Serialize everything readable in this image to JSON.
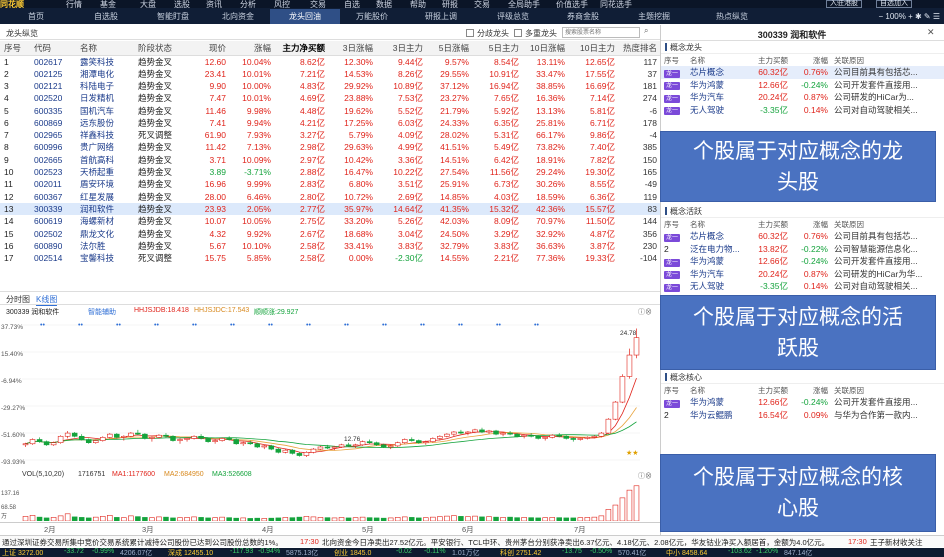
{
  "app": {
    "name": "同花顺"
  },
  "menubar": {
    "items": [
      "行情",
      "基金",
      "大盘",
      "选股",
      "资讯",
      "分析",
      "风控",
      "交易",
      "自选",
      "数据",
      "帮助",
      "研报",
      "交易",
      "全局助手",
      "价值选手",
      "同花选手"
    ],
    "right_buttons": [
      "入驻港股",
      "自选加入"
    ]
  },
  "navbar": {
    "items": [
      "首页",
      "自选股",
      "智能盯盘",
      "北向资金",
      "龙头回油",
      "万能股价",
      "研报上调",
      "评级总览",
      "券商金股",
      "主题挖掘",
      "热点纵览"
    ],
    "active_index": 4,
    "zoom": "100%"
  },
  "grid": {
    "title": "龙头纵览",
    "checkbox1": "分歧龙头",
    "checkbox2": "多重龙头",
    "search_placeholder": "搜索股票名称",
    "columns": [
      "序号",
      "代码",
      "名称",
      "阶段状态",
      "现价",
      "涨幅",
      "主力净买额",
      "3日涨幅",
      "3日主力",
      "5日涨幅",
      "5日主力",
      "10日涨幅",
      "10日主力",
      "热度排名"
    ],
    "rows": [
      [
        "1",
        "002617",
        "露笑科技",
        "趋势金叉",
        "12.60",
        "10.04%",
        "8.62亿",
        "12.30%",
        "9.44亿",
        "9.57%",
        "8.54亿",
        "13.11%",
        "12.65亿",
        "117"
      ],
      [
        "2",
        "002125",
        "湘潭电化",
        "趋势金叉",
        "23.41",
        "10.01%",
        "7.21亿",
        "14.53%",
        "8.26亿",
        "29.55%",
        "10.91亿",
        "33.47%",
        "17.55亿",
        "37"
      ],
      [
        "3",
        "002121",
        "科陆电子",
        "趋势金叉",
        "9.90",
        "10.00%",
        "4.83亿",
        "29.92%",
        "10.89亿",
        "37.12%",
        "16.94亿",
        "38.85%",
        "16.69亿",
        "181"
      ],
      [
        "4",
        "002520",
        "日发精机",
        "趋势金叉",
        "7.47",
        "10.01%",
        "4.69亿",
        "23.88%",
        "7.53亿",
        "23.27%",
        "7.65亿",
        "16.36%",
        "7.14亿",
        "274"
      ],
      [
        "5",
        "600335",
        "国机汽车",
        "趋势金叉",
        "11.46",
        "9.98%",
        "4.48亿",
        "19.62%",
        "5.52亿",
        "21.79%",
        "5.92亿",
        "13.13%",
        "5.81亿",
        "-6"
      ],
      [
        "6",
        "600869",
        "远东股份",
        "趋势金叉",
        "7.41",
        "9.94%",
        "4.21亿",
        "17.25%",
        "6.03亿",
        "24.33%",
        "6.35亿",
        "25.81%",
        "6.71亿",
        "178"
      ],
      [
        "7",
        "002965",
        "祥鑫科技",
        "死叉调整",
        "61.90",
        "7.93%",
        "3.27亿",
        "5.79%",
        "4.09亿",
        "28.02%",
        "5.31亿",
        "66.17%",
        "9.86亿",
        "-4"
      ],
      [
        "8",
        "600996",
        "贵广网络",
        "趋势金叉",
        "11.42",
        "7.13%",
        "2.98亿",
        "29.63%",
        "4.99亿",
        "41.51%",
        "5.49亿",
        "73.82%",
        "7.40亿",
        "385"
      ],
      [
        "9",
        "002665",
        "首航高科",
        "趋势金叉",
        "3.71",
        "10.09%",
        "2.97亿",
        "10.42%",
        "3.36亿",
        "14.51%",
        "6.42亿",
        "18.91%",
        "7.82亿",
        "150"
      ],
      [
        "10",
        "002523",
        "天桥起重",
        "趋势金叉",
        "3.89",
        "-3.71%",
        "2.88亿",
        "16.47%",
        "10.22亿",
        "27.54%",
        "11.56亿",
        "29.24%",
        "19.30亿",
        "165"
      ],
      [
        "11",
        "002011",
        "盾安环境",
        "趋势金叉",
        "16.96",
        "9.99%",
        "2.83亿",
        "6.80%",
        "3.51亿",
        "25.91%",
        "6.73亿",
        "30.26%",
        "8.55亿",
        "-49"
      ],
      [
        "12",
        "600367",
        "红星发展",
        "趋势金叉",
        "28.00",
        "6.46%",
        "2.80亿",
        "10.72%",
        "2.69亿",
        "14.85%",
        "4.03亿",
        "18.59%",
        "6.36亿",
        "119"
      ],
      [
        "13",
        "300339",
        "润和软件",
        "趋势金叉",
        "23.93",
        "2.05%",
        "2.77亿",
        "35.97%",
        "14.64亿",
        "41.35%",
        "15.32亿",
        "42.36%",
        "15.57亿",
        "83"
      ],
      [
        "14",
        "600619",
        "海螺新材",
        "趋势金叉",
        "10.07",
        "10.05%",
        "2.75亿",
        "33.20%",
        "5.26亿",
        "42.03%",
        "8.09亿",
        "70.97%",
        "11.50亿",
        "144"
      ],
      [
        "15",
        "002502",
        "鼎龙文化",
        "趋势金叉",
        "4.32",
        "9.92%",
        "2.67亿",
        "18.68%",
        "3.04亿",
        "24.50%",
        "3.29亿",
        "32.92%",
        "4.87亿",
        "356"
      ],
      [
        "16",
        "600890",
        "法尔胜",
        "趋势金叉",
        "5.67",
        "10.10%",
        "2.58亿",
        "33.41%",
        "3.83亿",
        "32.79%",
        "3.83亿",
        "36.63%",
        "3.87亿",
        "230"
      ],
      [
        "17",
        "002514",
        "宝馨科技",
        "死叉调整",
        "15.75",
        "5.85%",
        "2.58亿",
        "0.00%",
        "-2.30亿",
        "14.55%",
        "2.21亿",
        "77.36%",
        "19.33亿",
        "-104"
      ]
    ],
    "selected_index": 12
  },
  "chart_tabs": [
    "分时图",
    "K线图"
  ],
  "chart_tab_active": 1,
  "kline": {
    "stock": "300339 润和软件",
    "ind": "智能辅助",
    "ma1": "HHJSJDB:18.418",
    "ma2": "HHJSJDC:17.543",
    "ma3": "顺顺涨:29.927",
    "yticks": [
      "37.73%",
      "15.40%",
      "-6.94%",
      "-29.27%",
      "-51.60%",
      "-93.93%"
    ],
    "high_label": "24.78",
    "low_label": "12.76",
    "chart_data": {
      "type": "candlestick",
      "points": [
        [
          13.9,
          14.1,
          13.7,
          14.0
        ],
        [
          14.0,
          14.5,
          13.9,
          14.4
        ],
        [
          14.4,
          14.6,
          14.1,
          14.2
        ],
        [
          14.2,
          14.3,
          13.8,
          13.9
        ],
        [
          13.9,
          14.2,
          13.8,
          14.1
        ],
        [
          14.1,
          14.8,
          14.0,
          14.7
        ],
        [
          14.7,
          15.2,
          14.5,
          15.0
        ],
        [
          15.0,
          15.1,
          14.6,
          14.7
        ],
        [
          14.7,
          14.9,
          14.3,
          14.4
        ],
        [
          14.4,
          14.5,
          14.0,
          14.1
        ],
        [
          14.1,
          14.4,
          14.0,
          14.3
        ],
        [
          14.3,
          14.7,
          14.2,
          14.6
        ],
        [
          14.6,
          15.0,
          14.5,
          14.9
        ],
        [
          14.9,
          15.0,
          14.5,
          14.6
        ],
        [
          14.6,
          14.8,
          14.3,
          14.7
        ],
        [
          14.7,
          15.1,
          14.6,
          15.0
        ],
        [
          15.0,
          15.3,
          14.8,
          14.9
        ],
        [
          14.9,
          15.0,
          14.4,
          14.5
        ],
        [
          14.5,
          14.7,
          14.2,
          14.6
        ],
        [
          14.6,
          14.9,
          14.5,
          14.8
        ],
        [
          14.8,
          15.0,
          14.6,
          14.7
        ],
        [
          14.7,
          14.8,
          14.2,
          14.3
        ],
        [
          14.3,
          14.5,
          14.0,
          14.4
        ],
        [
          14.4,
          14.6,
          14.2,
          14.5
        ],
        [
          14.5,
          14.8,
          14.4,
          14.7
        ],
        [
          14.7,
          14.9,
          14.4,
          14.5
        ],
        [
          14.5,
          14.6,
          14.1,
          14.2
        ],
        [
          14.2,
          14.4,
          14.0,
          14.3
        ],
        [
          14.3,
          14.6,
          14.2,
          14.5
        ],
        [
          14.5,
          14.7,
          14.3,
          14.4
        ],
        [
          14.4,
          14.5,
          13.9,
          14.0
        ],
        [
          14.0,
          14.2,
          13.8,
          14.1
        ],
        [
          14.1,
          14.3,
          13.9,
          14.0
        ],
        [
          14.0,
          14.1,
          13.6,
          13.7
        ],
        [
          13.7,
          13.9,
          13.5,
          13.8
        ],
        [
          13.8,
          13.9,
          13.4,
          13.5
        ],
        [
          13.5,
          13.6,
          13.1,
          13.2
        ],
        [
          13.2,
          13.5,
          13.1,
          13.4
        ],
        [
          13.4,
          13.5,
          13.0,
          13.1
        ],
        [
          13.1,
          13.2,
          12.8,
          12.9
        ],
        [
          12.9,
          13.3,
          12.76,
          13.2
        ],
        [
          13.2,
          13.6,
          13.1,
          13.5
        ],
        [
          13.5,
          13.8,
          13.4,
          13.7
        ],
        [
          13.7,
          13.9,
          13.5,
          13.6
        ],
        [
          13.6,
          13.8,
          13.4,
          13.7
        ],
        [
          13.7,
          14.0,
          13.6,
          13.9
        ],
        [
          13.9,
          14.1,
          13.7,
          13.8
        ],
        [
          13.8,
          14.0,
          13.6,
          13.9
        ],
        [
          13.9,
          14.3,
          13.8,
          14.2
        ],
        [
          14.2,
          14.4,
          14.0,
          14.1
        ],
        [
          14.1,
          14.2,
          13.8,
          13.9
        ],
        [
          13.9,
          14.0,
          13.6,
          13.7
        ],
        [
          13.7,
          13.9,
          13.5,
          13.8
        ],
        [
          13.8,
          14.2,
          13.7,
          14.1
        ],
        [
          14.1,
          14.5,
          14.0,
          14.4
        ],
        [
          14.4,
          14.6,
          14.2,
          14.3
        ],
        [
          14.3,
          14.4,
          14.0,
          14.1
        ],
        [
          14.1,
          14.3,
          13.9,
          14.2
        ],
        [
          14.2,
          14.6,
          14.1,
          14.5
        ],
        [
          14.5,
          14.8,
          14.3,
          14.7
        ],
        [
          14.7,
          15.0,
          14.6,
          14.9
        ],
        [
          14.9,
          15.2,
          14.7,
          15.1
        ],
        [
          15.1,
          15.3,
          14.9,
          15.0
        ],
        [
          15.0,
          15.2,
          14.8,
          15.1
        ],
        [
          15.1,
          15.4,
          15.0,
          15.3
        ],
        [
          15.3,
          15.5,
          15.0,
          15.1
        ],
        [
          15.1,
          15.3,
          14.9,
          15.2
        ],
        [
          15.2,
          15.3,
          14.8,
          14.9
        ],
        [
          14.9,
          15.1,
          14.7,
          15.0
        ],
        [
          15.0,
          15.2,
          14.8,
          14.9
        ],
        [
          14.9,
          15.0,
          14.6,
          14.7
        ],
        [
          14.7,
          14.9,
          14.5,
          14.8
        ],
        [
          14.8,
          15.0,
          14.6,
          14.7
        ],
        [
          14.7,
          14.8,
          14.4,
          14.5
        ],
        [
          14.5,
          14.7,
          14.3,
          14.6
        ],
        [
          14.6,
          14.9,
          14.5,
          14.8
        ],
        [
          14.8,
          15.0,
          14.6,
          14.7
        ],
        [
          14.7,
          14.8,
          14.4,
          14.5
        ],
        [
          14.5,
          14.6,
          14.2,
          14.4
        ],
        [
          14.4,
          14.6,
          14.3,
          14.5
        ],
        [
          14.5,
          14.7,
          14.4,
          14.6
        ],
        [
          14.6,
          14.8,
          14.5,
          14.7
        ],
        [
          14.7,
          15.1,
          14.6,
          15.0
        ],
        [
          15.0,
          16.4,
          14.9,
          16.3
        ],
        [
          16.3,
          18.0,
          16.2,
          17.9
        ],
        [
          17.9,
          20.5,
          17.8,
          20.3
        ],
        [
          20.3,
          22.9,
          20.1,
          22.3
        ],
        [
          22.3,
          24.78,
          22.0,
          23.93
        ]
      ]
    }
  },
  "volume": {
    "label": "VOL(5,10,20)",
    "value": "1716751",
    "ma1": "MA1:1177600",
    "ma2": "MA2:684950",
    "ma3": "MA3:526608",
    "yticks": [
      "137.16",
      "68.58",
      "万"
    ],
    "chart_data": {
      "type": "bar",
      "values": [
        18,
        22,
        15,
        12,
        14,
        20,
        28,
        16,
        14,
        12,
        15,
        18,
        22,
        14,
        13,
        20,
        17,
        14,
        13,
        16,
        15,
        12,
        13,
        14,
        16,
        14,
        12,
        13,
        15,
        13,
        11,
        12,
        10,
        11,
        10,
        11,
        12,
        14,
        13,
        15,
        18,
        16,
        14,
        13,
        12,
        14,
        12,
        13,
        15,
        13,
        12,
        11,
        12,
        14,
        16,
        14,
        12,
        13,
        15,
        17,
        19,
        21,
        18,
        17,
        19,
        16,
        17,
        15,
        14,
        15,
        13,
        14,
        13,
        12,
        13,
        14,
        13,
        12,
        12,
        13,
        14,
        15,
        20,
        45,
        62,
        90,
        120,
        137
      ]
    }
  },
  "xaxis": {
    "labels": [
      "2月",
      "3月",
      "4月",
      "5月",
      "6月",
      "7月"
    ]
  },
  "news": {
    "time1": "17:30",
    "text1": "通过深圳证券交易所集中竞价交易系统累计减持公司股份已达到公司股份总数的1%。",
    "time2": "17:30",
    "text2": "北向资金今日净卖出27.52亿元。平安银行、TCL中环、贵州茅台分别获净卖出6.37亿元、4.18亿元、2.08亿元，华友钴业净买入额居首，金额为4.0亿元。",
    "time3": "17:30",
    "text3": "王子新材收关注"
  },
  "status": {
    "items": [
      "上证 3272.00",
      "-33.72",
      "-0.99%",
      "4206.07亿",
      "深成 12455.10",
      "-117.93",
      "-0.94%",
      "5875.13亿",
      "创业 1845.0",
      "-0.02",
      "-0.11%",
      "1.01万亿",
      "科创 2751.42",
      "-13.75",
      "-0.50%",
      "570.41亿",
      "中小 8458.64",
      "-103.62",
      "-1.20%",
      "847.14亿"
    ]
  },
  "right": {
    "title": "300339 润和软件",
    "sections": [
      {
        "name": "概念龙头",
        "cols": [
          "序号",
          "名称",
          "主力买额",
          "涨幅",
          "关联原因"
        ],
        "rows": [
          [
            "龙一",
            "芯片概念",
            "60.32亿",
            "0.76%",
            "公司目前具有包括芯..."
          ],
          [
            "龙一",
            "华为鸿蒙",
            "12.66亿",
            "-0.24%",
            "公司开发套件直接用..."
          ],
          [
            "龙一",
            "华为汽车",
            "20.24亿",
            "0.87%",
            "公司研发的HiCar为..."
          ],
          [
            "龙一",
            "无人驾驶",
            "-3.35亿",
            "0.14%",
            "公司对自动驾驶相关..."
          ]
        ]
      },
      {
        "name": "概念活跃",
        "cols": [
          "序号",
          "名称",
          "主力买额",
          "涨幅",
          "关联原因"
        ],
        "rows": [
          [
            "龙一",
            "芯片概念",
            "60.32亿",
            "0.76%",
            "公司目前具有包括芯..."
          ],
          [
            "2",
            "泛在电力物...",
            "13.82亿",
            "-0.22%",
            "公司智慧能源信息化..."
          ],
          [
            "龙一",
            "华为鸿蒙",
            "12.66亿",
            "-0.24%",
            "公司开发套件直接用..."
          ],
          [
            "龙一",
            "华为汽车",
            "20.24亿",
            "0.87%",
            "公司研发的HiCar为华..."
          ],
          [
            "龙一",
            "无人驾驶",
            "-3.35亿",
            "0.14%",
            "公司对自动驾驶相关..."
          ]
        ]
      },
      {
        "name": "概念核心",
        "cols": [
          "序号",
          "名称",
          "主力买额",
          "涨幅",
          "关联原因"
        ],
        "rows": [
          [
            "龙一",
            "华为鸿蒙",
            "12.66亿",
            "-0.24%",
            "公司开发套件直接用..."
          ],
          [
            "2",
            "华为云鲲鹏",
            "16.54亿",
            "0.09%",
            "与华为合作第一款内..."
          ]
        ]
      }
    ]
  },
  "overlays": [
    "个股属于对应概念的龙头股",
    "个股属于对应概念的活跃股",
    "个股属于对应概念的核心股"
  ],
  "colors": {
    "up": "#e0241b",
    "down": "#14a33c",
    "ma1": "#e0241b",
    "ma2": "#e8a33c",
    "ma3": "#14a33c",
    "overlay": "#4a72c1",
    "topbar": "#101e36"
  }
}
